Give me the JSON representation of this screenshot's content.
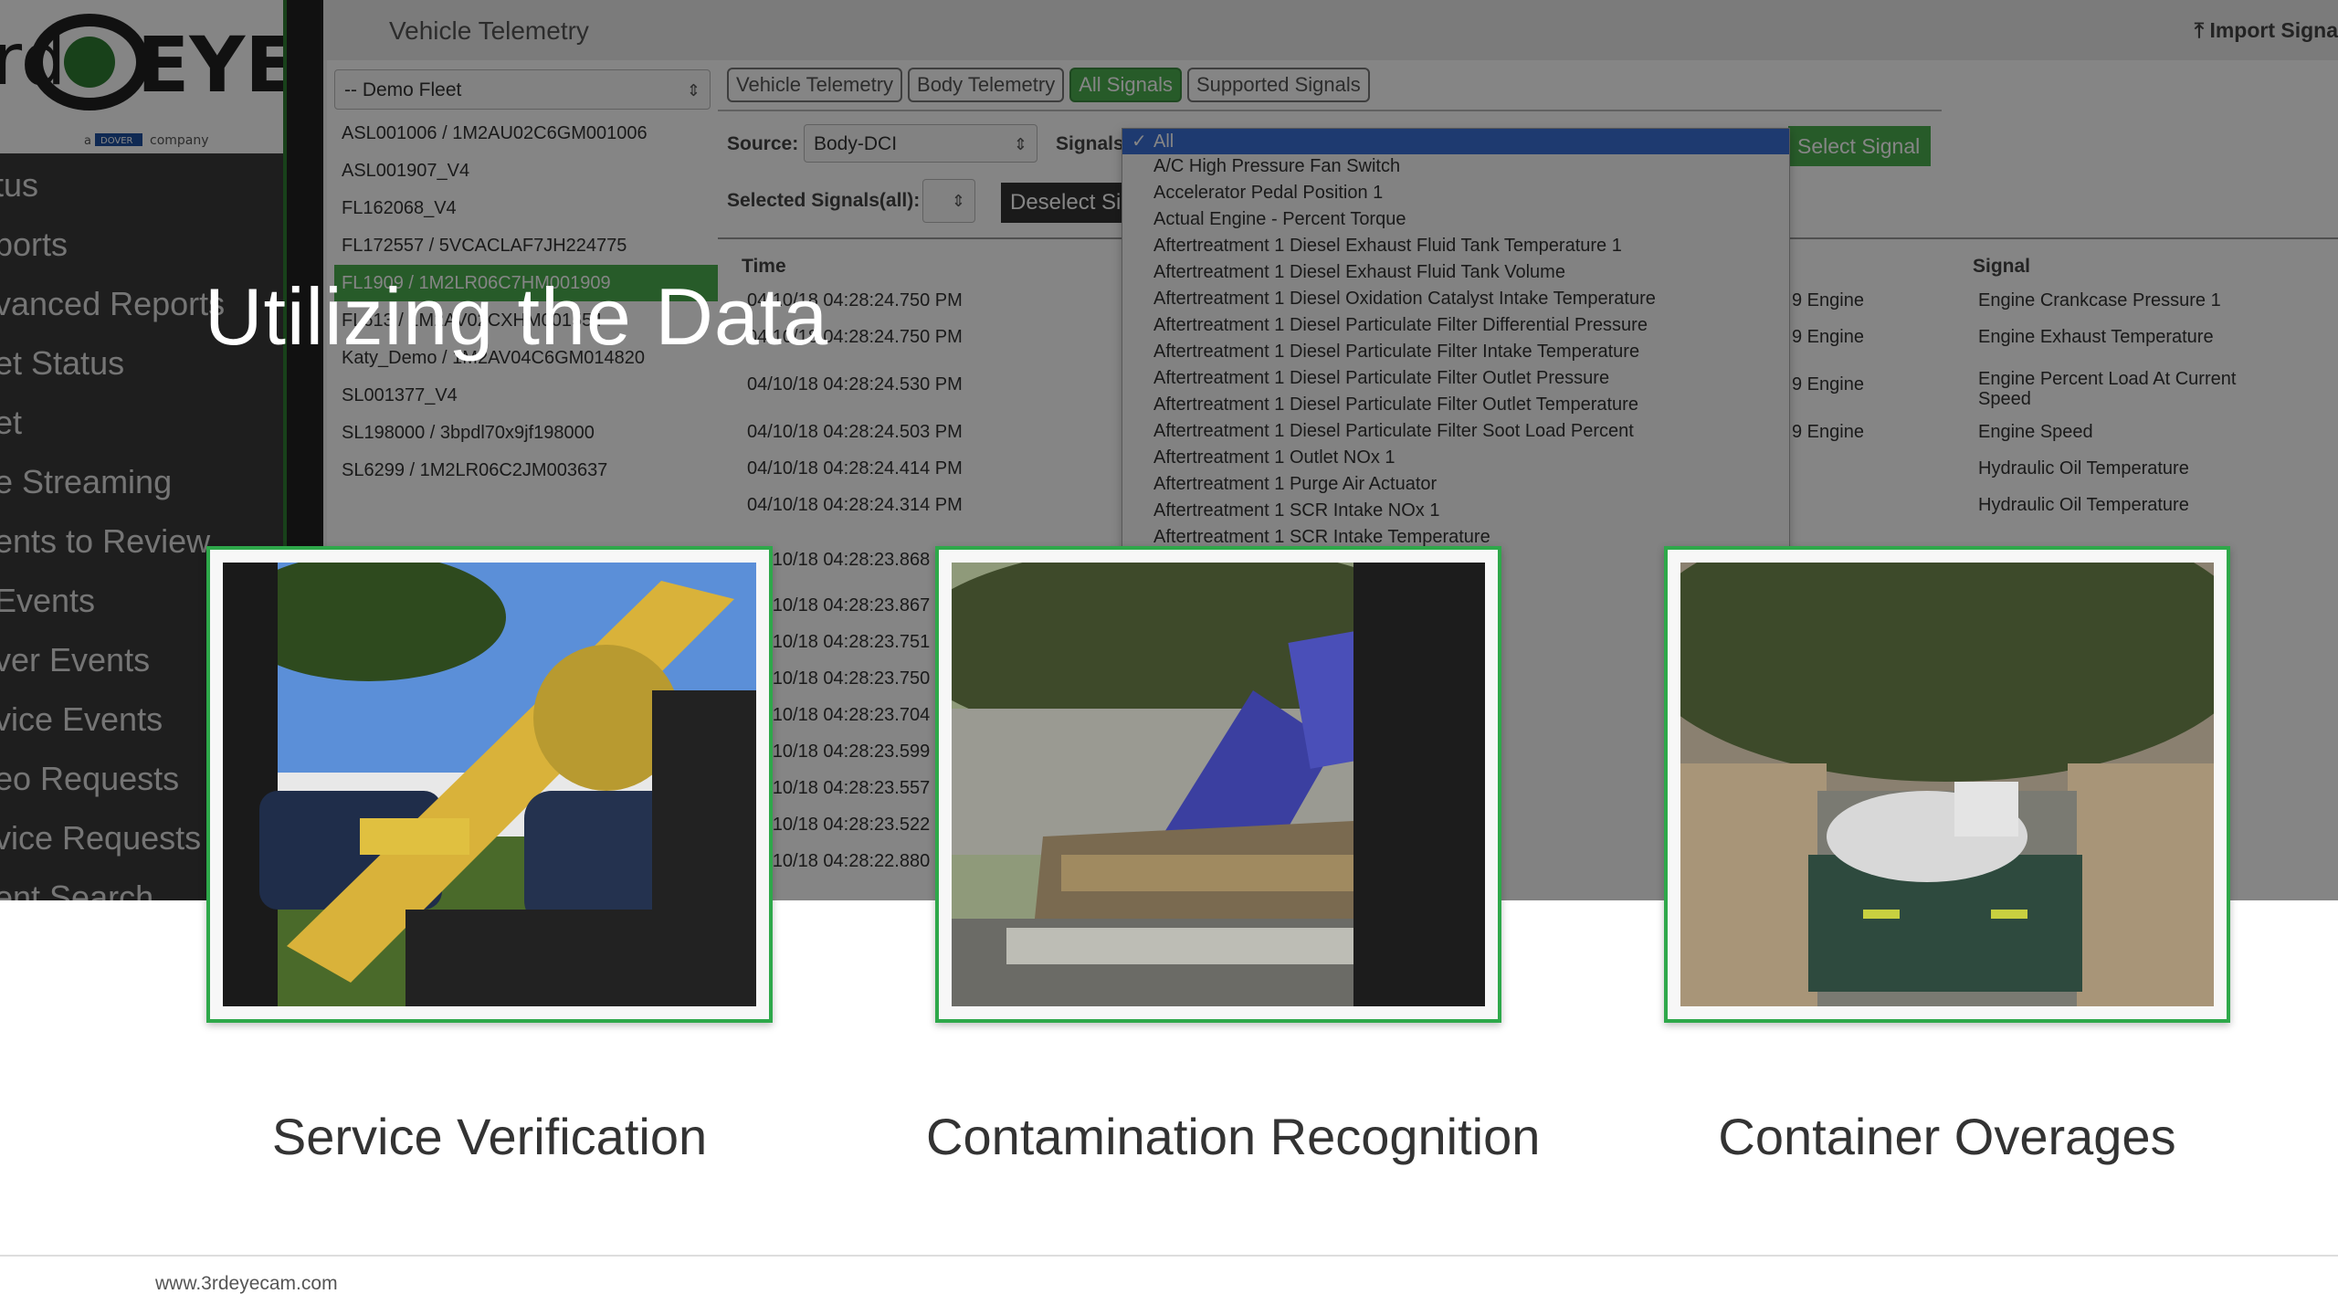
{
  "app": {
    "header_title": "Vehicle Telemetry",
    "import_button": "Import Signa",
    "logo": {
      "text_left": "rd",
      "text_right": "EYE",
      "tagline_badge": "DOVER",
      "tagline": "a company"
    },
    "sidebar_items": [
      "tus",
      "ports",
      "vanced Reports",
      "et Status",
      "et",
      "e Streaming",
      "ents to Review",
      "Events",
      "ver Events",
      "vice Events",
      "eo Requests",
      "vice Requests",
      "ent Search"
    ],
    "fleet_select": "-- Demo Fleet",
    "fleet_items": [
      "ASL001006 / 1M2AU02C6GM001006",
      "ASL001907_V4",
      "FL162068_V4",
      "FL172557 / 5VCACLAF7JH224775",
      "FL1909 / 1M2LR06C7HM001909",
      "FL613 / 1M2AV02CXHM001554",
      "Katy_Demo / 1M2AV04C6GM014820",
      "SL001377_V4",
      "SL198000 / 3bpdl70x9jf198000",
      "SL6299 / 1M2LR06C2JM003637"
    ],
    "tabs": [
      "Vehicle Telemetry",
      "Body Telemetry",
      "All Signals",
      "Supported Signals"
    ],
    "source_label": "Source:",
    "source_value": "Body-DCI",
    "signals_label": "Signals",
    "selected_signals_label": "Selected Signals(all):",
    "deselect_button": "Deselect Si",
    "select_signal_button": "Select Signal",
    "col_time": "Time",
    "col_signal": "Signal",
    "times": [
      "04/10/18 04:28:24.750 PM",
      "04/10/18 04:28:24.750 PM",
      "04/10/18 04:28:24.530 PM",
      "04/10/18 04:28:24.503 PM",
      "04/10/18 04:28:24.414 PM",
      "04/10/18 04:28:24.314 PM",
      "04/10/18 04:28:23.868",
      "04/10/18 04:28:23.867",
      "04/10/18 04:28:23.751",
      "04/10/18 04:28:23.750",
      "04/10/18 04:28:23.704",
      "04/10/18 04:28:23.599",
      "04/10/18 04:28:23.557",
      "04/10/18 04:28:23.522",
      "04/10/18 04:28:22.880"
    ],
    "sources": [
      "9 Engine",
      "9 Engine",
      "9 Engine",
      "9 Engine"
    ],
    "signals": [
      "Engine Crankcase Pressure 1",
      "Engine Exhaust Temperature",
      "Engine Percent Load At Current Speed",
      "Engine Speed",
      "Hydraulic Oil Temperature",
      "Hydraulic Oil Temperature"
    ],
    "dropdown_options": [
      "All",
      "A/C High Pressure Fan Switch",
      "Accelerator Pedal Position 1",
      "Actual Engine - Percent Torque",
      "Aftertreatment 1 Diesel Exhaust Fluid Tank Temperature 1",
      "Aftertreatment 1 Diesel Exhaust Fluid Tank Volume",
      "Aftertreatment 1 Diesel Oxidation Catalyst Intake Temperature",
      "Aftertreatment 1 Diesel Particulate Filter Differential Pressure",
      "Aftertreatment 1 Diesel Particulate Filter Intake Temperature",
      "Aftertreatment 1 Diesel Particulate Filter Outlet Pressure",
      "Aftertreatment 1 Diesel Particulate Filter Outlet Temperature",
      "Aftertreatment 1 Diesel Particulate Filter Soot Load Percent",
      "Aftertreatment 1 Outlet NOx 1",
      "Aftertreatment 1 Purge Air Actuator",
      "Aftertreatment 1 SCR Intake NOx 1",
      "Aftertreatment 1 SCR Intake Temperature"
    ]
  },
  "slide": {
    "title": "Utilizing the Data",
    "captions": [
      "Service Verification",
      "Contamination Recognition",
      "Container Overages"
    ],
    "footer_url": "www.3rdeyecam.com"
  },
  "colors": {
    "accent_green": "#2ea84a",
    "selection_blue": "#3b6fd6"
  }
}
